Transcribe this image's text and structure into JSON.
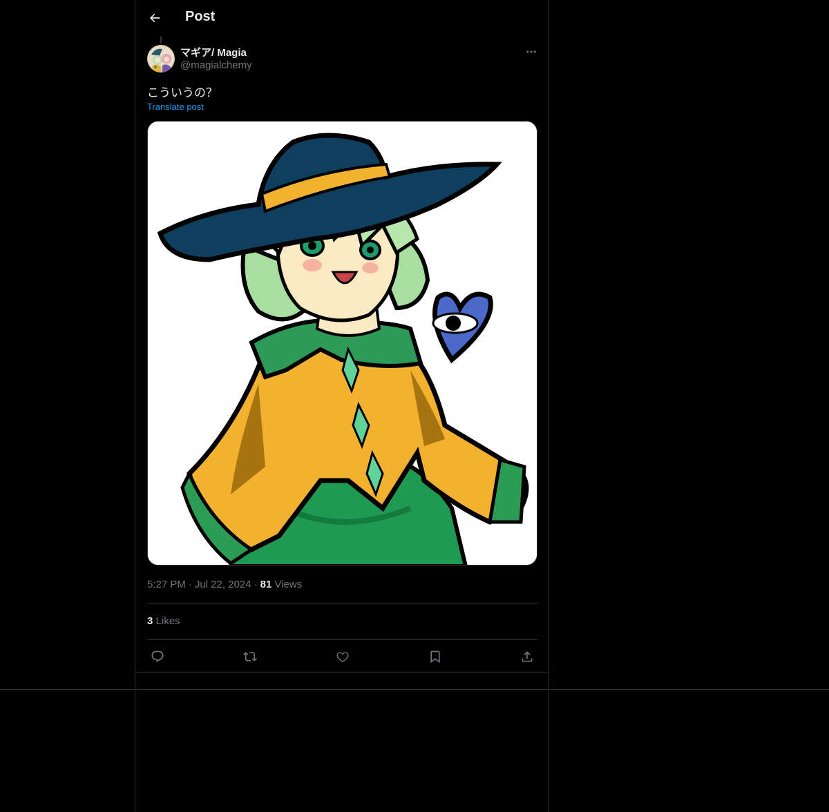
{
  "header": {
    "title": "Post",
    "back_icon": "arrow-left-icon"
  },
  "post": {
    "author": {
      "display_name": "マギア/ Magia",
      "handle": "@magialchemy"
    },
    "text": "こういうの？",
    "translate_label": "Translate post",
    "time": "5:27 PM",
    "date": "Jul 22, 2024",
    "views_count": "81",
    "views_label": "Views",
    "likes_count": "3",
    "likes_label": "Likes"
  },
  "actions": [
    {
      "name": "reply",
      "icon": "reply-icon"
    },
    {
      "name": "repost",
      "icon": "repost-icon"
    },
    {
      "name": "like",
      "icon": "heart-icon"
    },
    {
      "name": "bookmark",
      "icon": "bookmark-icon"
    },
    {
      "name": "share",
      "icon": "share-icon"
    }
  ],
  "colors": {
    "background": "#000000",
    "text_primary": "#e7e9ea",
    "text_secondary": "#71767b",
    "link": "#1d9bf0",
    "border": "#2f3336"
  }
}
